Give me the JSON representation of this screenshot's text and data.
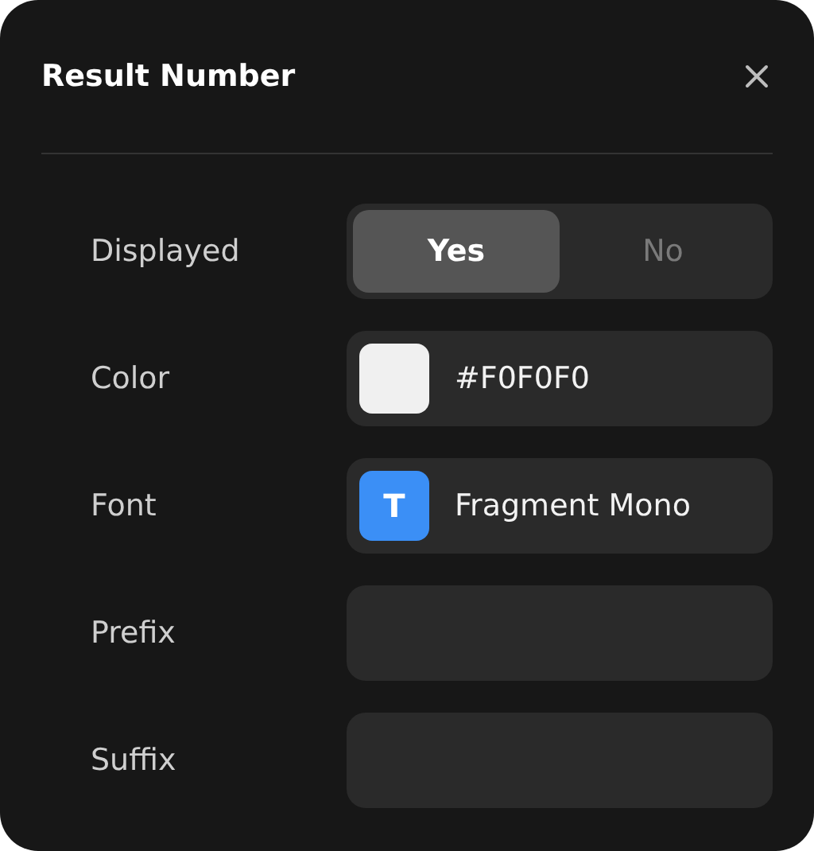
{
  "panel": {
    "title": "Result Number"
  },
  "rows": [
    {
      "kind": "segmented",
      "label": "Displayed",
      "options": [
        {
          "label": "Yes",
          "selected": true
        },
        {
          "label": "No",
          "selected": false
        }
      ]
    },
    {
      "kind": "color",
      "label": "Color",
      "color": "#f0f0f0",
      "value": "#F0F0F0"
    },
    {
      "kind": "font",
      "label": "Font",
      "icon_letter": "T",
      "value": "Fragment Mono"
    },
    {
      "kind": "text",
      "label": "Prefix"
    },
    {
      "kind": "text",
      "label": "Suffix"
    }
  ]
}
